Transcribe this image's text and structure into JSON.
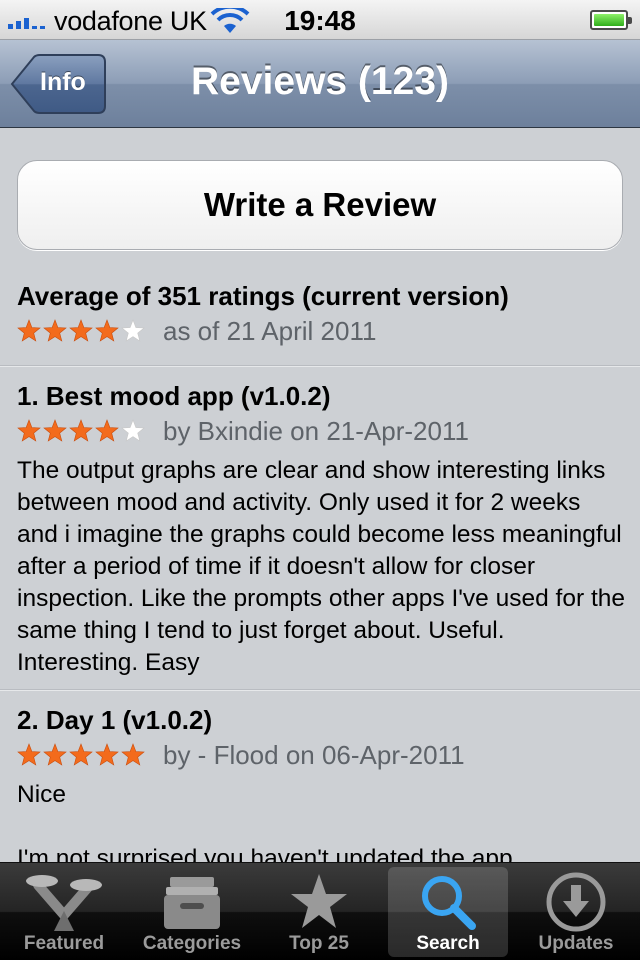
{
  "status_bar": {
    "carrier": "vodafone UK",
    "time": "19:48"
  },
  "nav": {
    "back_label": "Info",
    "title": "Reviews (123)"
  },
  "write_review_label": "Write a Review",
  "average": {
    "heading": "Average of 351 ratings (current version)",
    "rating": 4,
    "date_text": "as of 21 April 2011"
  },
  "reviews": [
    {
      "title": "1. Best mood app (v1.0.2)",
      "rating": 4,
      "byline": "by Bxindie on 21-Apr-2011",
      "body": "The output graphs are clear and show interesting links between mood and activity. Only used it for 2 weeks and i imagine the graphs could become less meaningful after a period of time if it doesn't allow for closer inspection. Like the prompts other apps I've used for the same thing I tend to just forget about. Useful. Interesting. Easy"
    },
    {
      "title": "2. Day 1 (v1.0.2)",
      "rating": 5,
      "byline": "by - Flood on 06-Apr-2011",
      "body_line1": "Nice",
      "body_line2": "I'm not surprised you haven't updated the app"
    }
  ],
  "tabs": [
    {
      "label": "Featured",
      "icon": "featured-icon"
    },
    {
      "label": "Categories",
      "icon": "categories-icon"
    },
    {
      "label": "Top 25",
      "icon": "star-icon"
    },
    {
      "label": "Search",
      "icon": "search-icon",
      "active": true
    },
    {
      "label": "Updates",
      "icon": "updates-icon"
    }
  ],
  "colors": {
    "star_filled": "#f36b1c",
    "star_empty": "#ffffff",
    "nav_bar": "#8c9db6",
    "signal": "#1b62d0",
    "search_icon": "#3aa5f2"
  }
}
